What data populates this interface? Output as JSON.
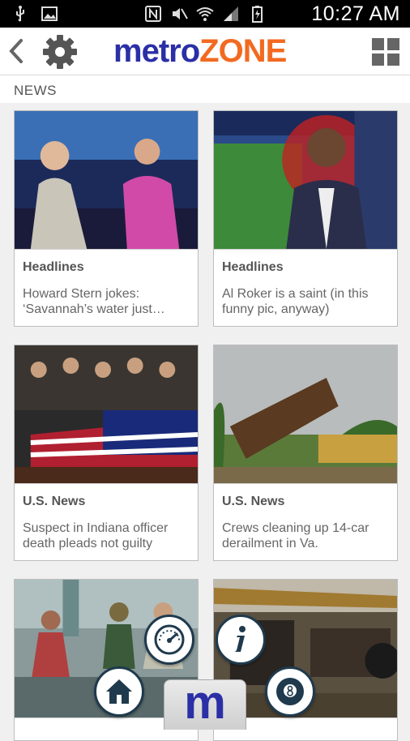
{
  "status_bar": {
    "time": "10:27 AM",
    "icons": [
      "usb-icon",
      "image-icon",
      "nfc-icon",
      "mute-icon",
      "wifi-icon",
      "signal-icon",
      "battery-icon"
    ]
  },
  "header": {
    "logo_part1": "metro",
    "logo_part2": "ZONE",
    "brand_blue": "#2b2fa6",
    "brand_orange": "#f26a21"
  },
  "section": {
    "label": "NEWS"
  },
  "cards": [
    {
      "category": "Headlines",
      "headline": "Howard Stern jokes:\n‘Savannah’s water just…"
    },
    {
      "category": "Headlines",
      "headline": "Al Roker is a saint (in this\nfunny pic, anyway)"
    },
    {
      "category": "U.S. News",
      "headline": "Suspect in Indiana officer\ndeath pleads not guilty"
    },
    {
      "category": "U.S. News",
      "headline": "Crews cleaning up 14-car\nderailment in Va."
    },
    {
      "category": "",
      "headline": ""
    },
    {
      "category": "",
      "headline": ""
    }
  ],
  "bottom_nav": {
    "m_label": "m",
    "buttons": [
      "home-icon",
      "speedometer-icon",
      "info-icon",
      "eight-ball-icon"
    ]
  }
}
